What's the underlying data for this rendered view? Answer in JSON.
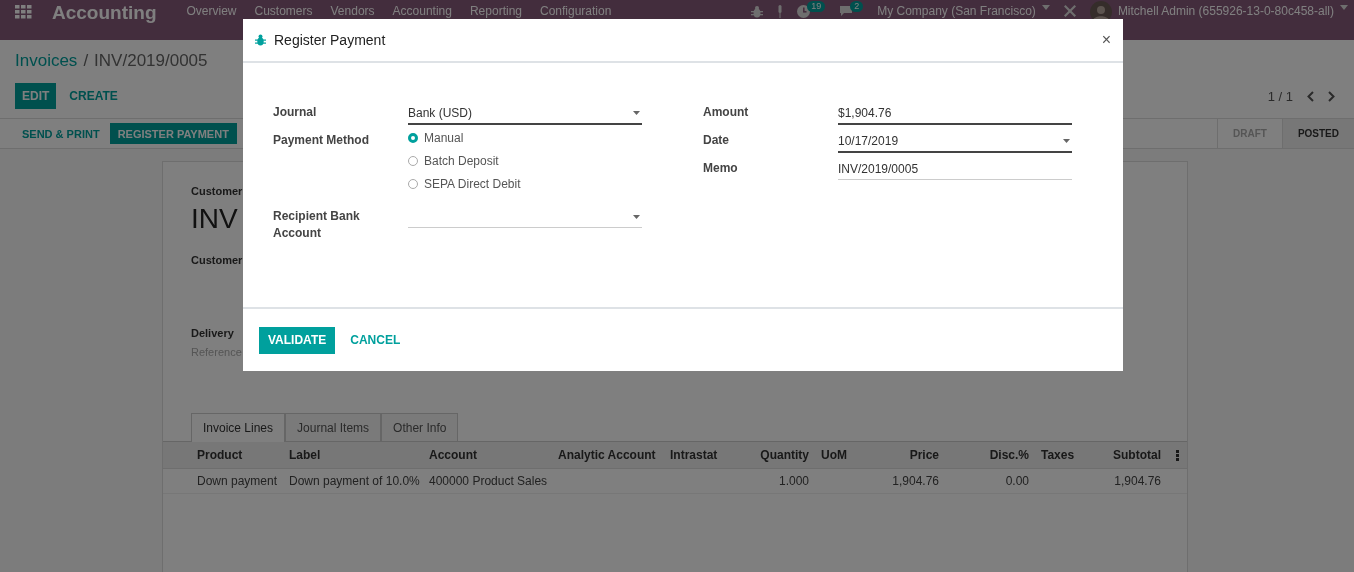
{
  "navbar": {
    "app_title": "Accounting",
    "menu": [
      "Overview",
      "Customers",
      "Vendors",
      "Accounting",
      "Reporting",
      "Configuration"
    ],
    "activity_count": "19",
    "message_count": "2",
    "company": "My Company (San Francisco)",
    "user": "Mitchell Admin (655926-13-0-80c458-all)"
  },
  "breadcrumb": {
    "items": [
      "Invoices",
      "INV/2019/0005"
    ],
    "separator": "/"
  },
  "buttons": [
    {
      "label": "EDIT",
      "kind": "primary"
    },
    {
      "label": "CREATE",
      "kind": "link"
    }
  ],
  "pager": "1 / 1",
  "header_buttons": [
    {
      "label": "SEND & PRINT",
      "kind": "link"
    },
    {
      "label": "REGISTER PAYMENT",
      "kind": "primary"
    }
  ],
  "statuses": [
    {
      "label": "DRAFT",
      "selected": false
    },
    {
      "label": "POSTED",
      "selected": true
    }
  ],
  "sheet": {
    "subtitle": "Customer",
    "title": "INV",
    "customer_label": "Customer",
    "delivery_label": "Delivery",
    "reference_placeholder": "Reference"
  },
  "tabs": [
    {
      "label": "Invoice Lines",
      "selected": true
    },
    {
      "label": "Journal Items",
      "selected": false
    },
    {
      "label": "Other Info",
      "selected": false
    }
  ],
  "table": {
    "columns": [
      "Product",
      "Label",
      "Account",
      "Analytic Account",
      "Intrastat",
      "Quantity",
      "UoM",
      "Price",
      "Disc.%",
      "Taxes",
      "Subtotal"
    ],
    "rows": [
      [
        "Down payment",
        "Down payment of 10.0%",
        "400000 Product Sales",
        "",
        "",
        "1.000",
        "",
        "1,904.76",
        "0.00",
        "",
        "1,904.76"
      ]
    ]
  },
  "dialog": {
    "title": "Register Payment",
    "close": "×",
    "left": [
      {
        "kind": "select",
        "label": "Journal",
        "value": "Bank (USD)"
      },
      {
        "kind": "radio",
        "label": "Payment Method",
        "options": [
          {
            "label": "Manual",
            "selected": true
          },
          {
            "label": "Batch Deposit",
            "selected": false
          },
          {
            "label": "SEPA Direct Debit",
            "selected": false
          }
        ]
      },
      {
        "kind": "select",
        "label": "Recipient Bank Account"
      }
    ],
    "right": [
      {
        "kind": "input",
        "label": "Amount",
        "value": "$1,904.76"
      },
      {
        "kind": "select",
        "label": "Date",
        "value": "10/17/2019"
      },
      {
        "kind": "input",
        "label": "Memo",
        "value": "INV/2019/0005"
      }
    ],
    "buttons": [
      {
        "label": "VALIDATE",
        "kind": "primary"
      },
      {
        "label": "CANCEL",
        "kind": "link"
      }
    ]
  }
}
